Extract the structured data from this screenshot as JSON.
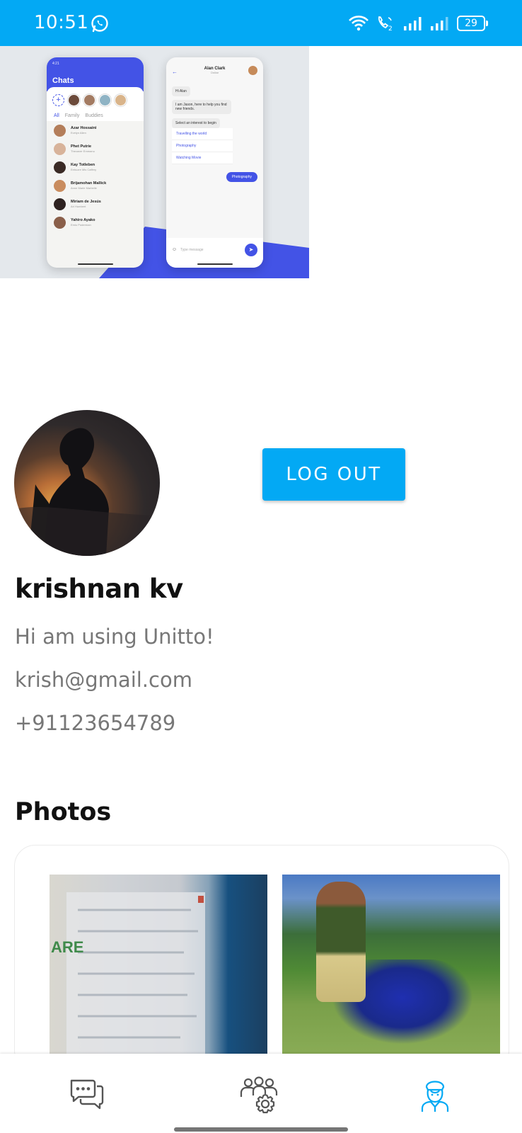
{
  "status_bar": {
    "time": "10:51",
    "battery": "29",
    "icons": [
      "whatsapp-icon",
      "wifi-icon",
      "volte-icon",
      "signal-icon",
      "signal-icon",
      "battery-icon"
    ],
    "background": "#03a9f4"
  },
  "banner": {
    "chat_list_phone": {
      "time": "4:21",
      "title": "Chats",
      "tabs": [
        "All",
        "Family",
        "Buddies"
      ],
      "chats": [
        {
          "name": "Azar Hossaini",
          "subtitle": "Evelyn Allen"
        },
        {
          "name": "Phet Putrie",
          "subtitle": "Thecaver Emmanu"
        },
        {
          "name": "Kay Totleben",
          "subtitle": "Eebuzre Mis Caffery"
        },
        {
          "name": "Brijamohan Mallick",
          "subtitle": "Anne Marie Marbelle"
        },
        {
          "name": "Miriam de Jesús",
          "subtitle": "Arl Humbert"
        },
        {
          "name": "Yahiro Ayako",
          "subtitle": "Emiu Poderman"
        }
      ]
    },
    "conversation_phone": {
      "contact_name": "Alan Clark",
      "contact_status": "Online",
      "messages": [
        "Hi Alan",
        "I am Jason, here to help you find new friends.",
        "Select an interest to begin"
      ],
      "options": [
        "Travelling the world",
        "Photography",
        "Watching Movie"
      ],
      "sent_message": "Photography",
      "input_placeholder": "Type message"
    }
  },
  "profile": {
    "logout_label": "LOG OUT",
    "name": "krishnan kv",
    "status": "Hi am using Unitto!",
    "email": "krish@gmail.com",
    "phone": "+91123654789"
  },
  "photos": {
    "title": "Photos"
  },
  "bottom_nav": {
    "items": [
      {
        "icon": "chat-bubbles-icon",
        "active": false
      },
      {
        "icon": "group-settings-icon",
        "active": false
      },
      {
        "icon": "user-profile-icon",
        "active": true
      }
    ],
    "active_color": "#03a9f4",
    "inactive_color": "#555555"
  }
}
